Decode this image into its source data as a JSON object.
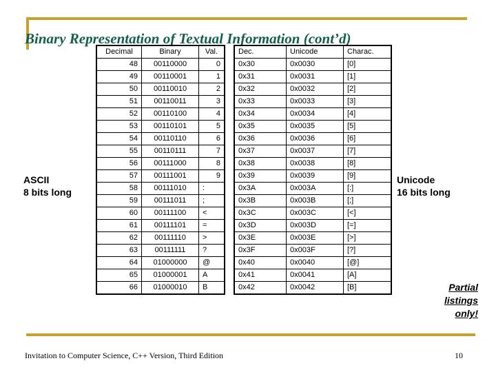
{
  "slide": {
    "title": "Binary Representation of Textual Information (cont’d)",
    "accent_color": "#c3a22e",
    "title_color": "#12604a",
    "page_number": "10",
    "footer": "Invitation to Computer Science, C++ Version, Third Edition"
  },
  "annotations": {
    "left": {
      "line1": "ASCII",
      "line2": "8 bits long"
    },
    "right": {
      "line1": "Unicode",
      "line2": "16 bits long"
    },
    "partial": {
      "line1": "Partial",
      "line2": "listings",
      "line3": "only!"
    }
  },
  "ascii_table": {
    "headers": [
      "Decimal",
      "Binary",
      "Val."
    ],
    "rows": [
      [
        "48",
        "00110000",
        "0"
      ],
      [
        "49",
        "00110001",
        "1"
      ],
      [
        "50",
        "00110010",
        "2"
      ],
      [
        "51",
        "00110011",
        "3"
      ],
      [
        "52",
        "00110100",
        "4"
      ],
      [
        "53",
        "00110101",
        "5"
      ],
      [
        "54",
        "00110110",
        "6"
      ],
      [
        "55",
        "00110111",
        "7"
      ],
      [
        "56",
        "00111000",
        "8"
      ],
      [
        "57",
        "00111001",
        "9"
      ],
      [
        "58",
        "00111010",
        ":"
      ],
      [
        "59",
        "00111011",
        ";"
      ],
      [
        "60",
        "00111100",
        "<"
      ],
      [
        "61",
        "00111101",
        "="
      ],
      [
        "62",
        "00111110",
        ">"
      ],
      [
        "63",
        "00111111",
        "?"
      ],
      [
        "64",
        "01000000",
        "@"
      ],
      [
        "65",
        "01000001",
        "A"
      ],
      [
        "66",
        "01000010",
        "B"
      ]
    ]
  },
  "unicode_table": {
    "headers": [
      "Dec.",
      "Unicode",
      "Charac."
    ],
    "rows": [
      [
        "0x30",
        "0x0030",
        "[0]"
      ],
      [
        "0x31",
        "0x0031",
        "[1]"
      ],
      [
        "0x32",
        "0x0032",
        "[2]"
      ],
      [
        "0x33",
        "0x0033",
        "[3]"
      ],
      [
        "0x34",
        "0x0034",
        "[4]"
      ],
      [
        "0x35",
        "0x0035",
        "[5]"
      ],
      [
        "0x36",
        "0x0036",
        "[6]"
      ],
      [
        "0x37",
        "0x0037",
        "[7]"
      ],
      [
        "0x38",
        "0x0038",
        "[8]"
      ],
      [
        "0x39",
        "0x0039",
        "[9]"
      ],
      [
        "0x3A",
        "0x003A",
        "[:]"
      ],
      [
        "0x3B",
        "0x003B",
        "[;]"
      ],
      [
        "0x3C",
        "0x003C",
        "[<]"
      ],
      [
        "0x3D",
        "0x003D",
        "[=]"
      ],
      [
        "0x3E",
        "0x003E",
        "[>]"
      ],
      [
        "0x3F",
        "0x003F",
        "[?]"
      ],
      [
        "0x40",
        "0x0040",
        "[@]"
      ],
      [
        "0x41",
        "0x0041",
        "[A]"
      ],
      [
        "0x42",
        "0x0042",
        "[B]"
      ]
    ]
  }
}
